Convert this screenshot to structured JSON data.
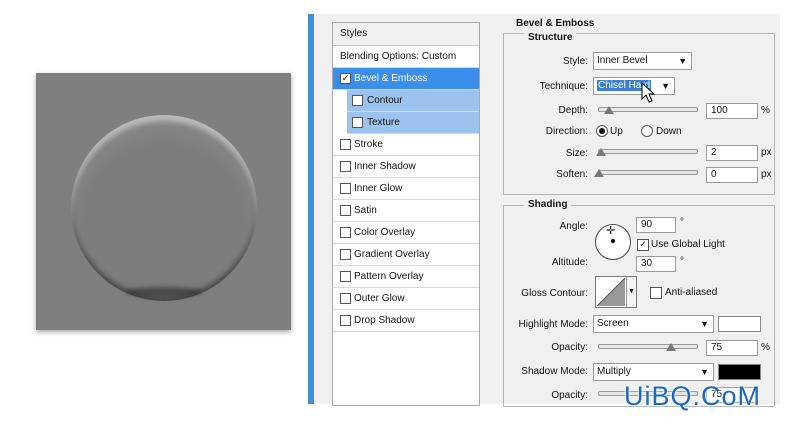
{
  "styles_panel": {
    "header": "Styles",
    "blending_options": "Blending Options: Custom",
    "items": [
      {
        "label": "Bevel & Emboss",
        "checked": true,
        "selected": true
      },
      {
        "label": "Contour",
        "checked": false,
        "sub": true
      },
      {
        "label": "Texture",
        "checked": false,
        "sub": true
      },
      {
        "label": "Stroke",
        "checked": false
      },
      {
        "label": "Inner Shadow",
        "checked": false
      },
      {
        "label": "Inner Glow",
        "checked": false
      },
      {
        "label": "Satin",
        "checked": false
      },
      {
        "label": "Color Overlay",
        "checked": false
      },
      {
        "label": "Gradient Overlay",
        "checked": false
      },
      {
        "label": "Pattern Overlay",
        "checked": false
      },
      {
        "label": "Outer Glow",
        "checked": false
      },
      {
        "label": "Drop Shadow",
        "checked": false
      }
    ]
  },
  "bevel": {
    "title": "Bevel & Emboss",
    "structure_title": "Structure",
    "style_label": "Style:",
    "style_value": "Inner Bevel",
    "technique_label": "Technique:",
    "technique_value": "Chisel Hard",
    "depth_label": "Depth:",
    "depth_value": "100",
    "depth_unit": "%",
    "direction_label": "Direction:",
    "direction_up": "Up",
    "direction_down": "Down",
    "size_label": "Size:",
    "size_value": "2",
    "size_unit": "px",
    "soften_label": "Soften:",
    "soften_value": "0",
    "soften_unit": "px"
  },
  "shading": {
    "title": "Shading",
    "angle_label": "Angle:",
    "angle_value": "90",
    "degree": "°",
    "use_global_light": "Use Global Light",
    "altitude_label": "Altitude:",
    "altitude_value": "30",
    "gloss_contour_label": "Gloss Contour:",
    "anti_aliased": "Anti-aliased",
    "highlight_mode_label": "Highlight Mode:",
    "highlight_mode_value": "Screen",
    "highlight_color": "#ffffff",
    "highlight_opacity_label": "Opacity:",
    "highlight_opacity_value": "75",
    "percent": "%",
    "shadow_mode_label": "Shadow Mode:",
    "shadow_mode_value": "Multiply",
    "shadow_color": "#000000",
    "shadow_opacity_label": "Opacity:",
    "shadow_opacity_value": "75"
  },
  "watermark": "UiBQ.CoM"
}
